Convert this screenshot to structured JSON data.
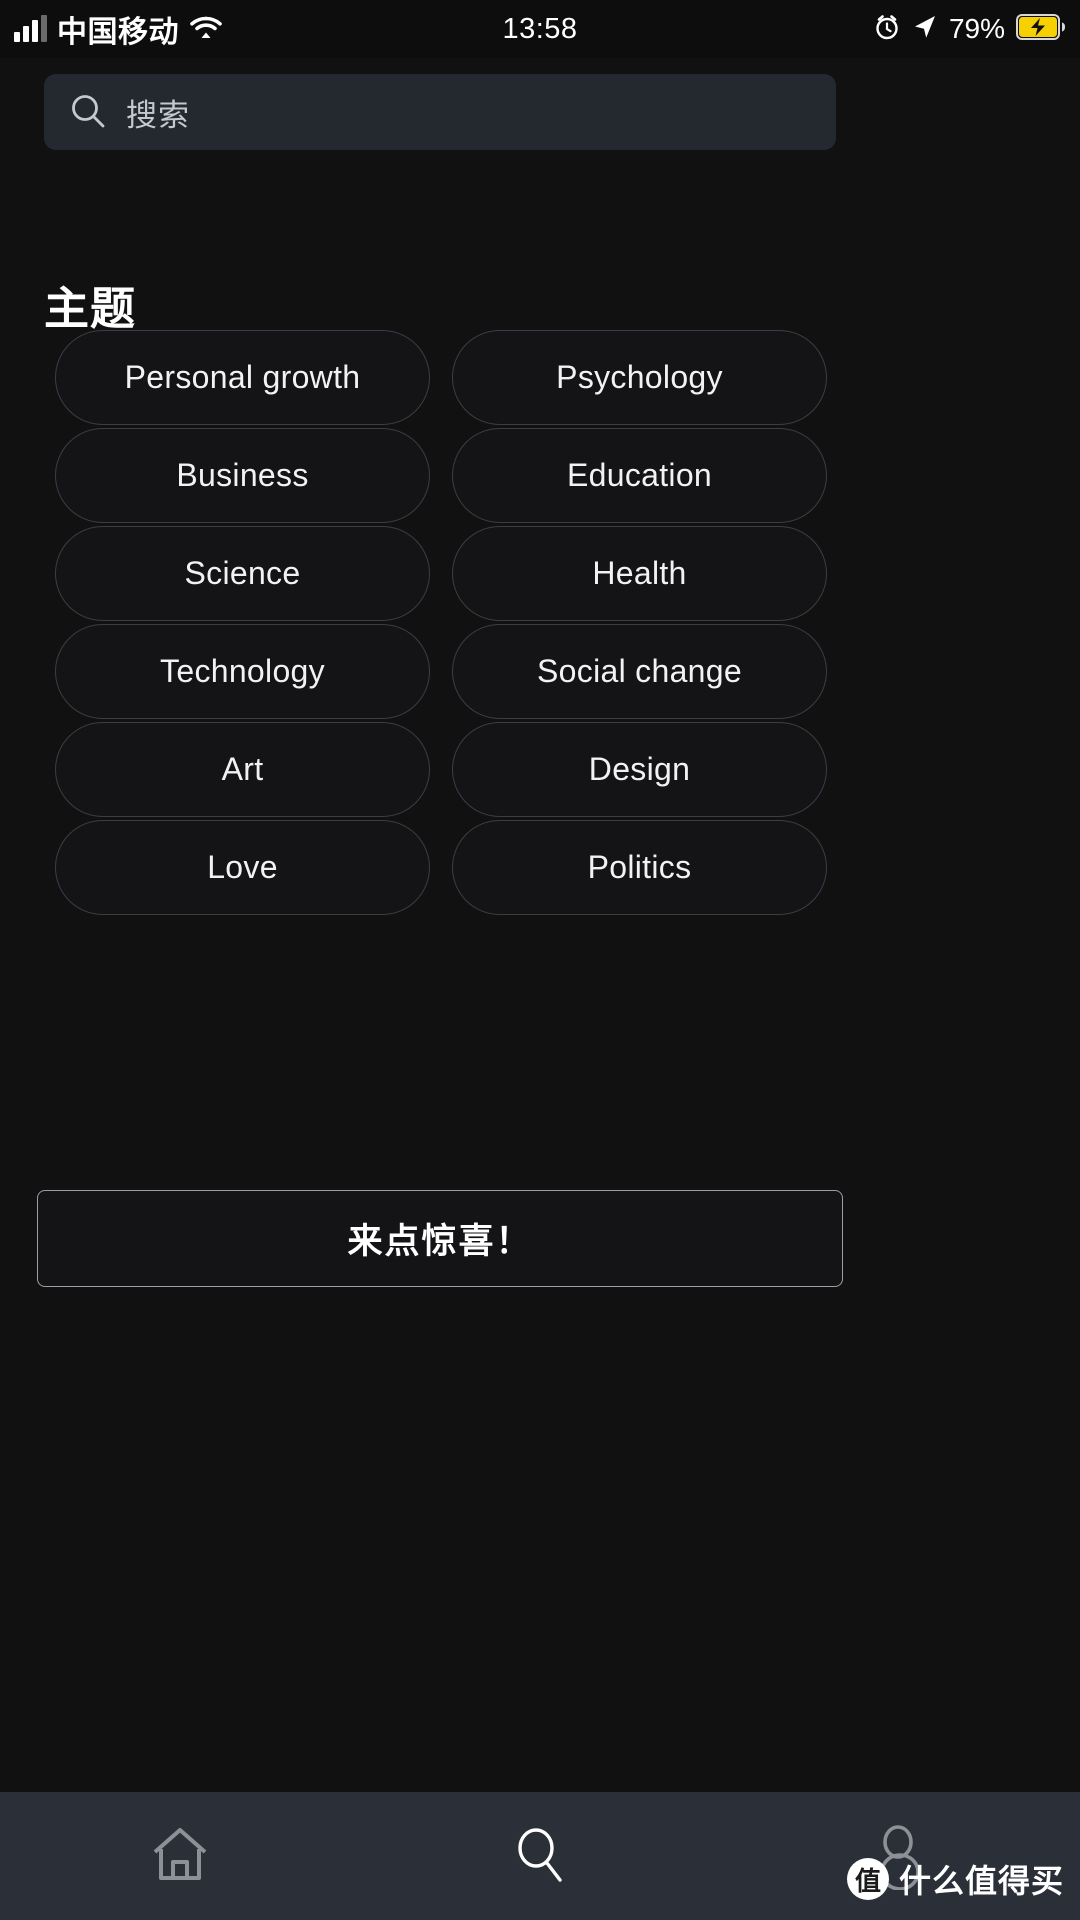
{
  "status_bar": {
    "carrier": "中国移动",
    "time": "13:58",
    "battery_percent": "79%",
    "icons": {
      "signal": "signal-bars-icon",
      "wifi": "wifi-icon",
      "alarm": "alarm-clock-icon",
      "location": "location-arrow-icon",
      "battery": "battery-charging-icon"
    },
    "battery_color": "#f6d000"
  },
  "search": {
    "placeholder": "搜索",
    "icon": "search-icon"
  },
  "topics": {
    "heading": "主题",
    "chips": [
      "Personal growth",
      "Psychology",
      "Business",
      "Education",
      "Science",
      "Health",
      "Technology",
      "Social change",
      "Art",
      "Design",
      "Love",
      "Politics"
    ]
  },
  "surprise_button": {
    "label": "来点惊喜！"
  },
  "bottom_nav": {
    "items": [
      {
        "name": "home",
        "icon": "home-icon",
        "active": false
      },
      {
        "name": "search",
        "icon": "search-icon",
        "active": true
      },
      {
        "name": "profile",
        "icon": "person-icon",
        "active": false
      }
    ],
    "active_color": "#ffffff",
    "inactive_color": "#8d9197",
    "background": "#2b3038"
  },
  "watermark": {
    "logo_char": "值",
    "text": "什么值得买"
  },
  "colors": {
    "page_background": "#111112",
    "search_background": "#24282f",
    "chip_border": "#3a3e44"
  }
}
